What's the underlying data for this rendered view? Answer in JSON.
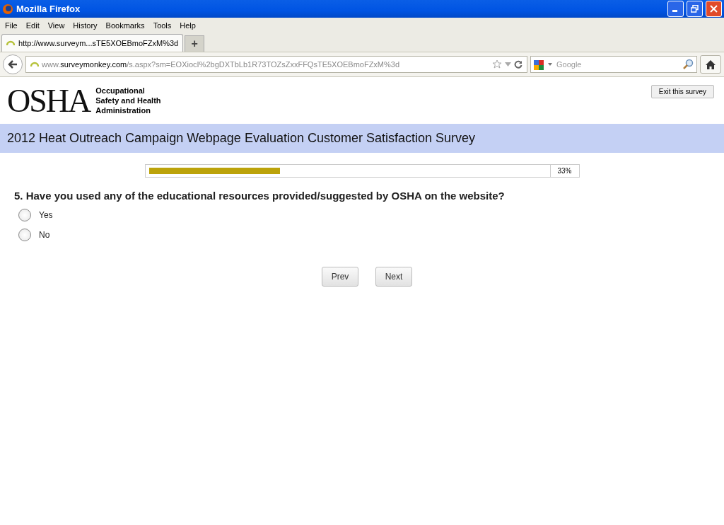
{
  "window": {
    "title": "Mozilla Firefox"
  },
  "menu": [
    "File",
    "Edit",
    "View",
    "History",
    "Bookmarks",
    "Tools",
    "Help"
  ],
  "tabs": [
    {
      "label": "http://www.surveym...sTE5XOEBmoFZxM%3d",
      "selected": true
    }
  ],
  "new_tab": "+",
  "address_bar": {
    "domain_prefix": "www.",
    "domain": "surveymonkey.com",
    "path": "/s.aspx?sm=EOXiocI%2bgDXTbLb1R73TOZsZxxFFQsTE5XOEBmoFZxM%3d"
  },
  "search": {
    "placeholder": "Google"
  },
  "header": {
    "logo": "OSHA",
    "org_lines": [
      "Occupational",
      "Safety and Health",
      "Administration"
    ],
    "exit_button": "Exit this survey"
  },
  "survey_title": "2012 Heat Outreach Campaign Webpage Evaluation Customer Satisfaction Survey",
  "progress": {
    "level": 0.33,
    "reading": "33%"
  },
  "question": "5. Have you used any of the educational resources provided/suggested by OSHA on the website?",
  "options": [
    {
      "label": "Yes",
      "selected": false
    },
    {
      "label": "No",
      "selected": false
    }
  ],
  "buttons": [
    "Prev",
    "Next"
  ]
}
